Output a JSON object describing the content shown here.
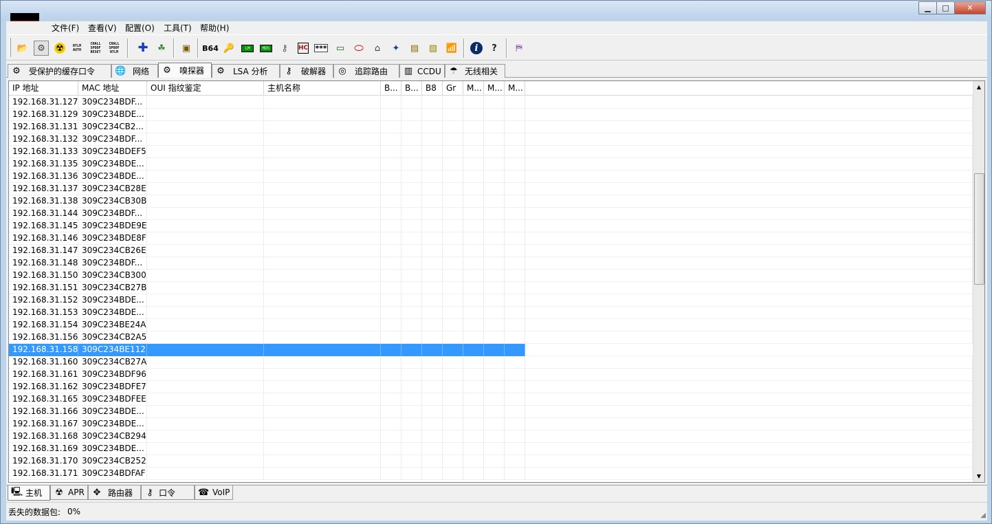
{
  "window": {
    "minimize_glyph": "▁",
    "maximize_glyph": "□",
    "close_glyph": "✕"
  },
  "menu": [
    "文件(F)",
    "查看(V)",
    "配置(O)",
    "工具(T)",
    "帮助(H)"
  ],
  "toolbar": {
    "open_icon": "📂",
    "sniffer_icon": "⚙",
    "apr_icon": "☢",
    "ntlm_auth_label": "NTLM AUTH",
    "chall_spoof_reset_label": "CHALL SPOOF RESET",
    "chall_spoof_ntlm_label": "CHALL SPOOF NTLM",
    "add_icon": "✚",
    "scan_icon": "☘",
    "cert_icon": "▣",
    "base64_label": "B64",
    "key_icon": "🔑",
    "lcd1_label": "LM",
    "lcd2_label": "MD5",
    "wireless_key_icon": "⚷",
    "hash_label": "HC",
    "password_label": "***",
    "monitor_icon": "▭",
    "route_icon": "⬭",
    "home_icon": "⌂",
    "network_icon": "✦",
    "stack_icon": "▤",
    "lock_icon": "▧",
    "wifi_icon": "📶",
    "info_icon": "i",
    "help_icon": "?",
    "exit_icon": "⛿"
  },
  "top_tabs": [
    {
      "label": "受保护的缓存口令",
      "icon": "⚙"
    },
    {
      "label": "网络",
      "icon": "🌐"
    },
    {
      "label": "嗅探器",
      "icon": "⚙"
    },
    {
      "label": "LSA 分析",
      "icon": "⚙"
    },
    {
      "label": "破解器",
      "icon": "⚷"
    },
    {
      "label": "追踪路由",
      "icon": "◎"
    },
    {
      "label": "CCDU",
      "icon": "▥"
    },
    {
      "label": "无线相关",
      "icon": "☂"
    }
  ],
  "columns": [
    "IP 地址",
    "MAC 地址",
    "OUI 指纹鉴定",
    "主机名称",
    "B...",
    "B...",
    "B8",
    "Gr",
    "M...",
    "M...",
    "M..."
  ],
  "rows": [
    [
      "192.168.31.127",
      "309C234BDF..."
    ],
    [
      "192.168.31.129",
      "309C234BDE..."
    ],
    [
      "192.168.31.131",
      "309C234CB2..."
    ],
    [
      "192.168.31.132",
      "309C234BDF..."
    ],
    [
      "192.168.31.133",
      "309C234BDEF5"
    ],
    [
      "192.168.31.135",
      "309C234BDE..."
    ],
    [
      "192.168.31.136",
      "309C234BDE..."
    ],
    [
      "192.168.31.137",
      "309C234CB28E"
    ],
    [
      "192.168.31.138",
      "309C234CB30B"
    ],
    [
      "192.168.31.144",
      "309C234BDF..."
    ],
    [
      "192.168.31.145",
      "309C234BDE9E"
    ],
    [
      "192.168.31.146",
      "309C234BDE8F"
    ],
    [
      "192.168.31.147",
      "309C234CB26E"
    ],
    [
      "192.168.31.148",
      "309C234BDF..."
    ],
    [
      "192.168.31.150",
      "309C234CB300"
    ],
    [
      "192.168.31.151",
      "309C234CB27B"
    ],
    [
      "192.168.31.152",
      "309C234BDE..."
    ],
    [
      "192.168.31.153",
      "309C234BDE..."
    ],
    [
      "192.168.31.154",
      "309C234BE24A"
    ],
    [
      "192.168.31.156",
      "309C234CB2A5"
    ],
    [
      "192.168.31.158",
      "309C234BE112"
    ],
    [
      "192.168.31.160",
      "309C234CB27A"
    ],
    [
      "192.168.31.161",
      "309C234BDF96"
    ],
    [
      "192.168.31.162",
      "309C234BDFE7"
    ],
    [
      "192.168.31.165",
      "309C234BDFEE"
    ],
    [
      "192.168.31.166",
      "309C234BDE..."
    ],
    [
      "192.168.31.167",
      "309C234BDE..."
    ],
    [
      "192.168.31.168",
      "309C234CB294"
    ],
    [
      "192.168.31.169",
      "309C234BDE..."
    ],
    [
      "192.168.31.170",
      "309C234CB252"
    ],
    [
      "192.168.31.171",
      "309C234BDFAF"
    ]
  ],
  "selected_row_ip": "192.168.31.158",
  "scroll": {
    "up_glyph": "▲",
    "down_glyph": "▼"
  },
  "bottom_tabs": [
    {
      "label": "主机",
      "icon": "🖳"
    },
    {
      "label": "APR",
      "icon": "☢"
    },
    {
      "label": "路由器",
      "icon": "✥"
    },
    {
      "label": "口令",
      "icon": "⚷"
    },
    {
      "label": "VoIP",
      "icon": "☎"
    }
  ],
  "status": {
    "label": "丢失的数据包:",
    "value": "0%"
  },
  "colors": {
    "selection": "#3399ff",
    "window_frame": "#bcd3ea",
    "close_button": "#c6452f"
  }
}
